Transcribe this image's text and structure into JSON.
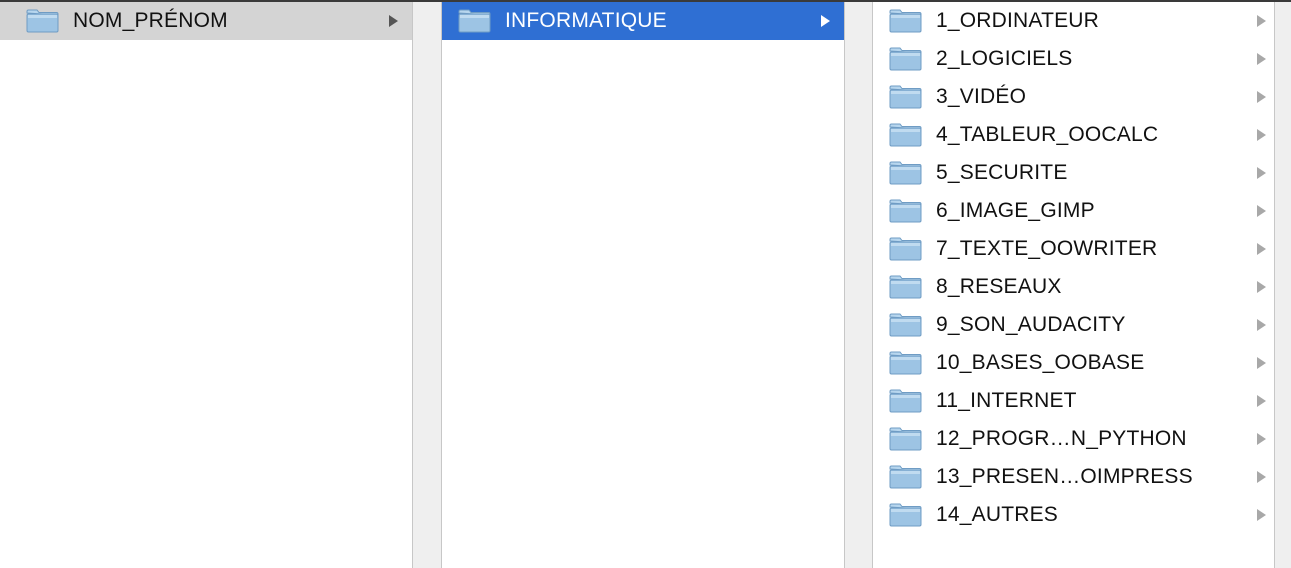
{
  "columns": {
    "col1": {
      "items": [
        {
          "label": "NOM_PRÉNOM",
          "icon": "folder-icon",
          "selected": "inactive"
        }
      ]
    },
    "col2": {
      "items": [
        {
          "label": "INFORMATIQUE",
          "icon": "folder-icon",
          "selected": "active"
        }
      ]
    },
    "col3": {
      "items": [
        {
          "label": "1_ORDINATEUR",
          "icon": "folder-icon"
        },
        {
          "label": "2_LOGICIELS",
          "icon": "folder-icon"
        },
        {
          "label": "3_VIDÉO",
          "icon": "folder-icon"
        },
        {
          "label": "4_TABLEUR_OOCALC",
          "icon": "folder-icon"
        },
        {
          "label": "5_SECURITE",
          "icon": "folder-icon"
        },
        {
          "label": "6_IMAGE_GIMP",
          "icon": "folder-icon"
        },
        {
          "label": "7_TEXTE_OOWRITER",
          "icon": "folder-icon"
        },
        {
          "label": "8_RESEAUX",
          "icon": "folder-icon"
        },
        {
          "label": "9_SON_AUDACITY",
          "icon": "folder-icon"
        },
        {
          "label": "10_BASES_OOBASE",
          "icon": "folder-icon"
        },
        {
          "label": "11_INTERNET",
          "icon": "folder-icon"
        },
        {
          "label": "12_PROGR…N_PYTHON",
          "icon": "folder-icon"
        },
        {
          "label": "13_PRESEN…OIMPRESS",
          "icon": "folder-icon"
        },
        {
          "label": "14_AUTRES",
          "icon": "folder-icon"
        }
      ]
    }
  },
  "colors": {
    "selection_active": "#2f6fd3",
    "selection_inactive": "#d4d4d4",
    "folder_body": "#9dc4e4",
    "folder_tab": "#b7d6ee"
  }
}
